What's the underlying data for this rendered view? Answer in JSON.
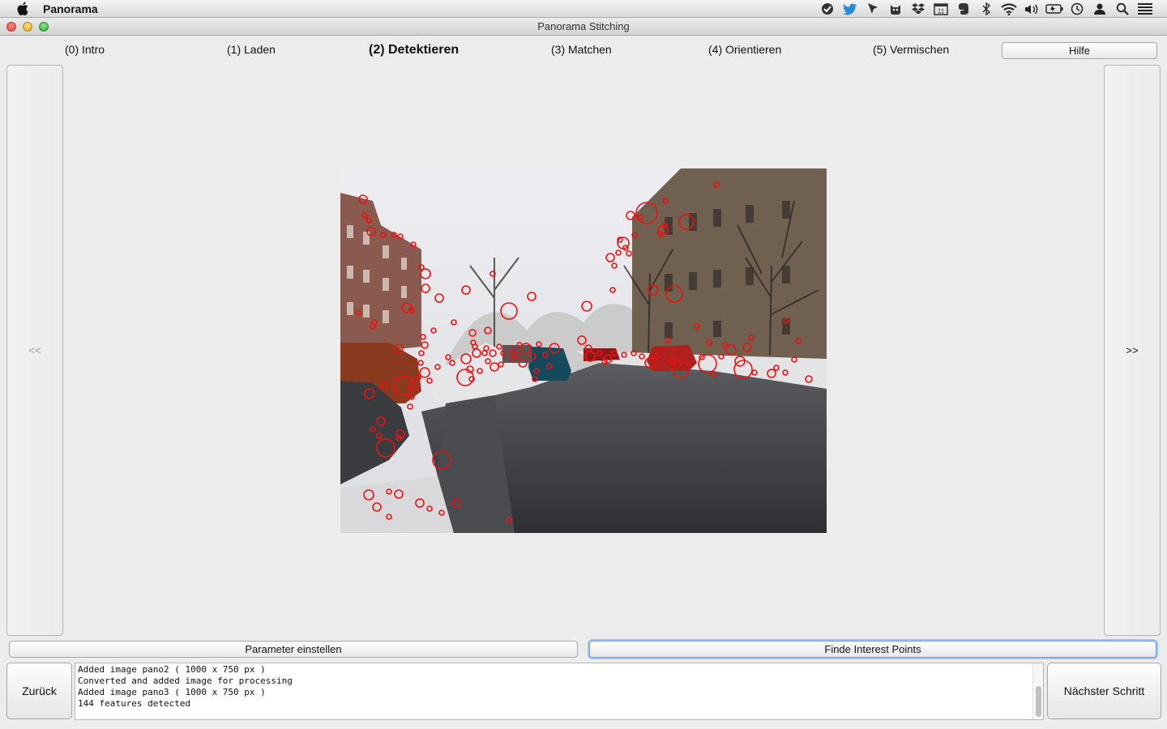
{
  "menubar": {
    "app_name": "Panorama",
    "status_icons": [
      "vpn-icon",
      "twitter-icon",
      "cursor-icon",
      "cat-icon",
      "dropbox-icon",
      "calendar-icon",
      "evernote-icon",
      "bluetooth-icon",
      "wifi-icon",
      "volume-icon",
      "battery-icon",
      "clock-icon",
      "user-icon",
      "search-icon",
      "list-icon"
    ]
  },
  "window": {
    "title": "Panorama Stitching"
  },
  "tabs": [
    {
      "label": "(0) Intro"
    },
    {
      "label": "(1) Laden"
    },
    {
      "label": "(2) Detektieren"
    },
    {
      "label": "(3) Matchen"
    },
    {
      "label": "(4) Orientieren"
    },
    {
      "label": "(5) Vermischen"
    }
  ],
  "help_label": "Hilfe",
  "nav": {
    "prev_label": "<<",
    "next_label": ">>"
  },
  "actions": {
    "params_label": "Parameter einstellen",
    "find_label": "Finde Interest Points",
    "back_label": "Zurück",
    "next_step_label": "Nächster Schritt"
  },
  "log": {
    "lines": [
      "Added image pano2 ( 1000 x 750 px )",
      "Converted and added image for processing",
      "Added image pano3 ( 1000 x 750 px )",
      "144 features detected"
    ]
  },
  "colors": {
    "feature_marker": "#ee1111",
    "focus_ring": "#6b9fe0"
  }
}
